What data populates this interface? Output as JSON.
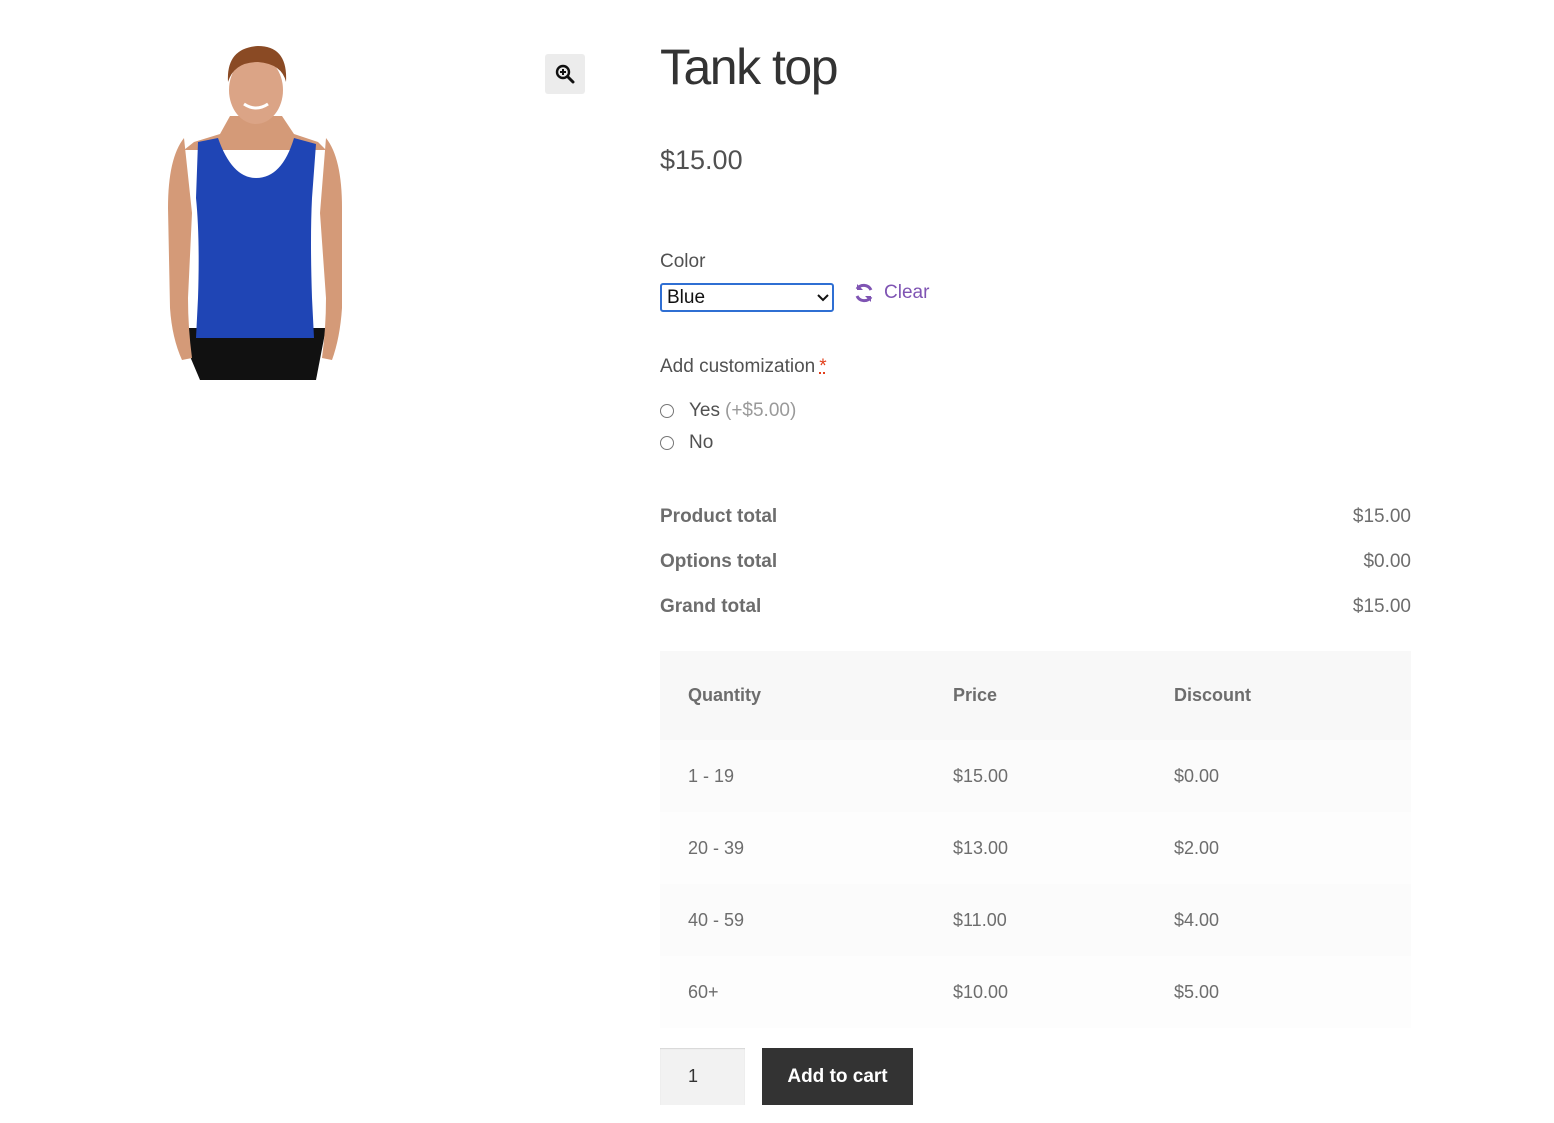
{
  "product": {
    "title": "Tank top",
    "price": "$15.00",
    "image_icon": "product-photo-tank-top",
    "zoom_icon": "magnifier-zoom-icon"
  },
  "variation": {
    "label": "Color",
    "selected": "Blue",
    "clear_label": "Clear"
  },
  "addon": {
    "label": "Add customization",
    "required_marker": "*",
    "options": [
      {
        "label": "Yes",
        "price": "(+$5.00)"
      },
      {
        "label": "No",
        "price": ""
      }
    ]
  },
  "totals": [
    {
      "label": "Product total",
      "value": "$15.00"
    },
    {
      "label": "Options total",
      "value": "$0.00"
    },
    {
      "label": "Grand total",
      "value": "$15.00"
    }
  ],
  "pricing_table": {
    "headers": [
      "Quantity",
      "Price",
      "Discount"
    ],
    "rows": [
      [
        "1 - 19",
        "$15.00",
        "$0.00"
      ],
      [
        "20 - 39",
        "$13.00",
        "$2.00"
      ],
      [
        "40 - 59",
        "$11.00",
        "$4.00"
      ],
      [
        "60+",
        "$10.00",
        "$5.00"
      ]
    ]
  },
  "cart": {
    "quantity": "1",
    "add_to_cart_label": "Add to cart"
  },
  "colors": {
    "accent_link": "#7f54b3",
    "button_bg": "#333333",
    "shirt_blue": "#1f45b5"
  }
}
